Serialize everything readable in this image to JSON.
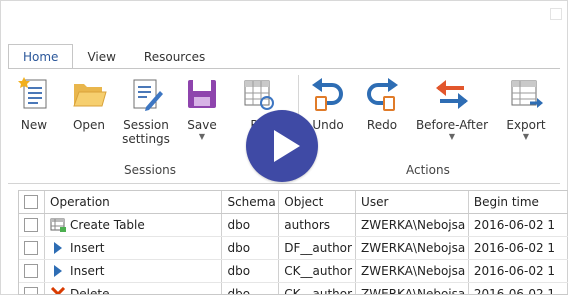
{
  "tabs": [
    "Home",
    "View",
    "Resources"
  ],
  "ribbon": {
    "buttons": {
      "new": "New",
      "open": "Open",
      "session_settings_1": "Session",
      "session_settings_2": "settings",
      "save": "Save",
      "report": "Re",
      "undo": "Undo",
      "redo": "Redo",
      "before_after": "Before-After",
      "export": "Export"
    },
    "groups": {
      "sessions": "Sessions",
      "actions": "Actions"
    }
  },
  "grid": {
    "columns": [
      "Operation",
      "Schema",
      "Object",
      "User",
      "Begin time"
    ],
    "rows": [
      {
        "operation": "Create Table",
        "icon": "table-icon",
        "schema": "dbo",
        "object": "authors",
        "user": "ZWERKA\\Nebojsa",
        "begin": "2016-06-02 1"
      },
      {
        "operation": "Insert",
        "icon": "insert-arrow-icon",
        "schema": "dbo",
        "object": "DF__author",
        "user": "ZWERKA\\Nebojsa",
        "begin": "2016-06-02 1"
      },
      {
        "operation": "Insert",
        "icon": "insert-arrow-icon",
        "schema": "dbo",
        "object": "CK__author",
        "user": "ZWERKA\\Nebojsa",
        "begin": "2016-06-02 1"
      },
      {
        "operation": "Delete",
        "icon": "delete-x-icon",
        "schema": "dbo",
        "object": "CK__author",
        "user": "ZWERKA\\Nebojsa",
        "begin": "2016-06-02 1"
      }
    ]
  },
  "colors": {
    "accent": "#2b579a",
    "play_button": "#3f4aa5",
    "delete": "#d83b01",
    "insert": "#2e6db4"
  }
}
